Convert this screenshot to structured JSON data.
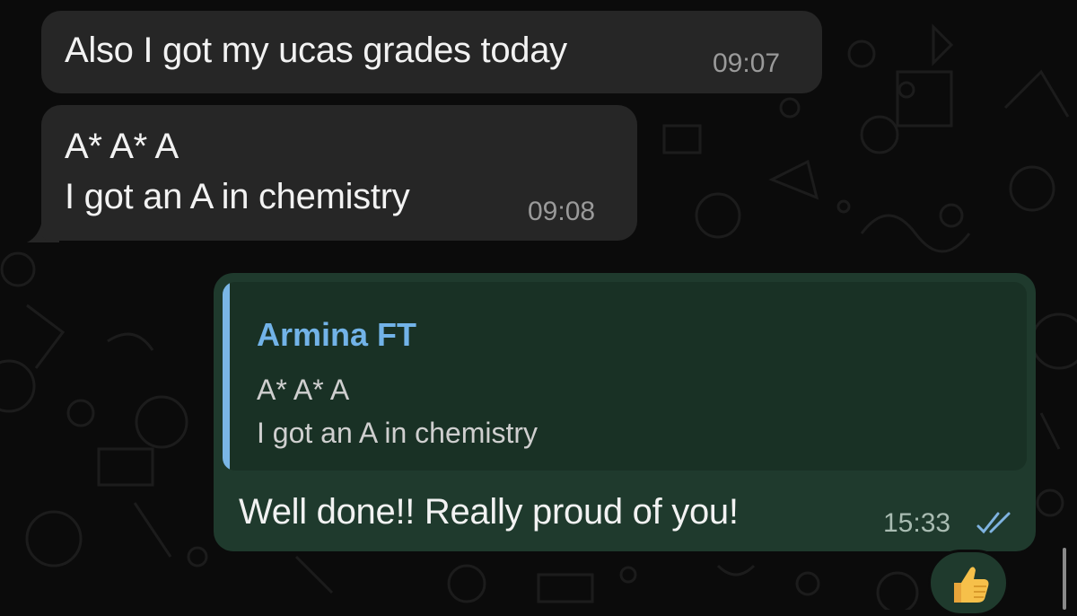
{
  "messages": [
    {
      "direction": "incoming",
      "text": "Also I got my ucas grades today",
      "time": "09:07"
    },
    {
      "direction": "incoming",
      "lines": [
        "A* A* A",
        "I got an A in chemistry"
      ],
      "time": "09:08"
    }
  ],
  "reply": {
    "quote": {
      "author": "Armina FT",
      "lines": [
        "A* A* A",
        "I got an A in chemistry"
      ]
    },
    "text": "Well done!! Really proud of you!",
    "time": "15:33",
    "status": "read"
  },
  "reaction": {
    "icon": "thumbs-up-icon"
  },
  "colors": {
    "background": "#0b0b0b",
    "incoming_bubble": "#262626",
    "outgoing_bubble": "#1f3a2d",
    "quote_accent": "#72b3e8"
  }
}
